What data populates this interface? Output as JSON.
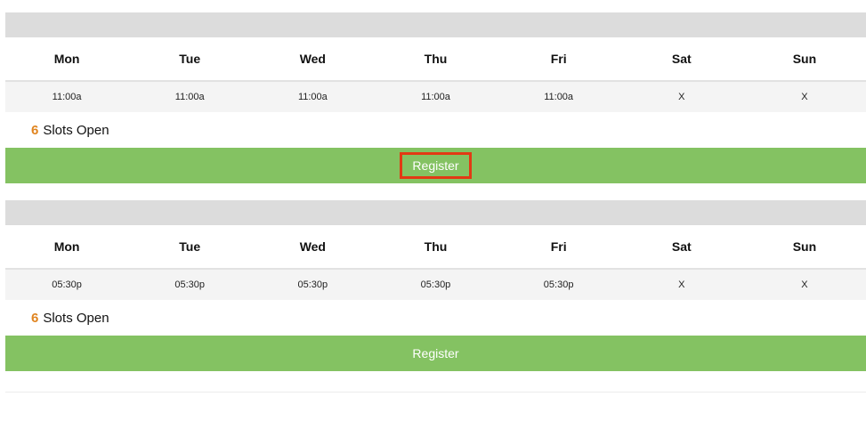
{
  "days": [
    "Mon",
    "Tue",
    "Wed",
    "Thu",
    "Fri",
    "Sat",
    "Sun"
  ],
  "schedules": [
    {
      "times": [
        "11:00a",
        "11:00a",
        "11:00a",
        "11:00a",
        "11:00a",
        "X",
        "X"
      ],
      "slots_count": "6",
      "slots_label": "Slots Open",
      "register_label": "Register"
    },
    {
      "times": [
        "05:30p",
        "05:30p",
        "05:30p",
        "05:30p",
        "05:30p",
        "X",
        "X"
      ],
      "slots_count": "6",
      "slots_label": "Slots Open",
      "register_label": "Register"
    }
  ],
  "colors": {
    "register_bar": "#84c262",
    "slots_count": "#e0841f",
    "highlight_border": "#e23a14",
    "header_bar": "#dcdcdc"
  }
}
